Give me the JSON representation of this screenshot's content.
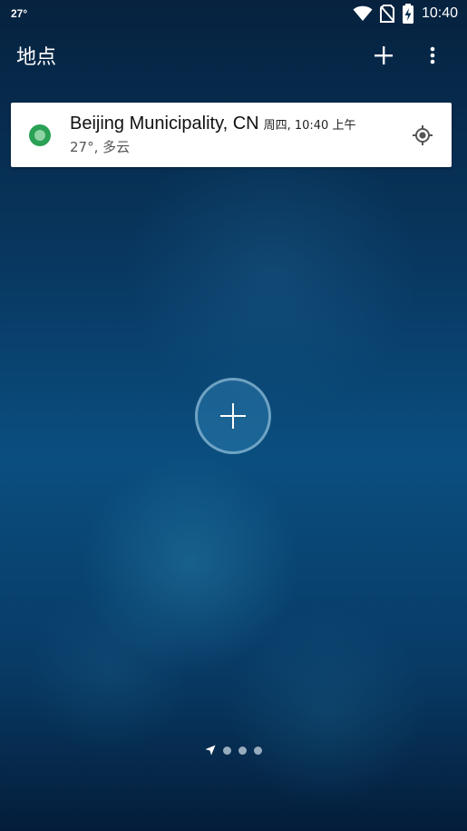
{
  "status_bar": {
    "temperature": "27°",
    "time": "10:40",
    "icons": [
      "wifi-icon",
      "no-sim-icon",
      "battery-charging-icon"
    ]
  },
  "app_bar": {
    "title": "地点",
    "actions": [
      "add-icon",
      "more-vert-icon"
    ]
  },
  "location_card": {
    "city": "Beijing Municipality, CN",
    "local_time": "周四, 10:40 上午",
    "conditions": "27°, 多云",
    "status_color": "#2aa155",
    "action_icon": "my-location-icon"
  },
  "center_button": {
    "icon": "add-icon"
  },
  "page_indicator": {
    "current_icon": "navigation-arrow-icon",
    "dots": 3
  },
  "colors": {
    "background_top": "#06223f",
    "background_mid": "#0a4e7f",
    "card_background": "#ffffff"
  }
}
